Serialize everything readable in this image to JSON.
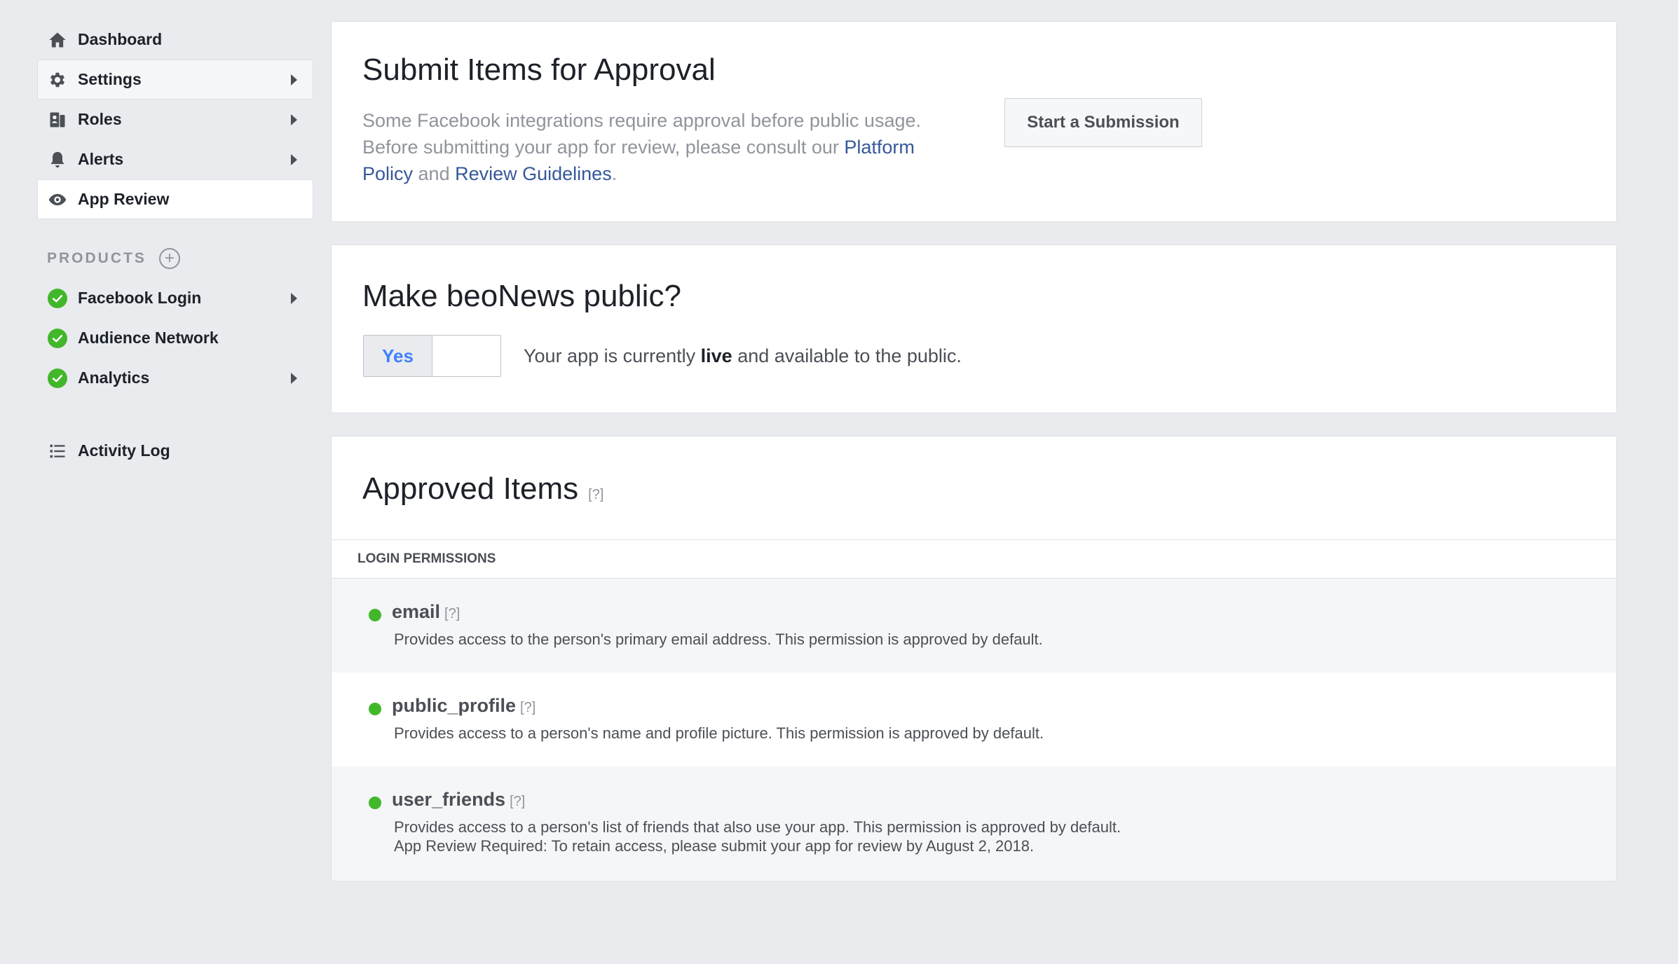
{
  "sidebar": {
    "items": [
      {
        "label": "Dashboard",
        "icon": "house-icon"
      },
      {
        "label": "Settings",
        "icon": "gear-icon"
      },
      {
        "label": "Roles",
        "icon": "roles-icon"
      },
      {
        "label": "Alerts",
        "icon": "bell-icon"
      },
      {
        "label": "App Review",
        "icon": "eye-icon"
      }
    ],
    "products_label": "PRODUCTS",
    "products_add_symbol": "+",
    "products": [
      {
        "label": "Facebook Login",
        "icon": "check-circle-icon"
      },
      {
        "label": "Audience Network",
        "icon": "check-circle-icon"
      },
      {
        "label": "Analytics",
        "icon": "check-circle-icon"
      }
    ],
    "activity_log": {
      "label": "Activity Log",
      "icon": "list-icon"
    }
  },
  "submit": {
    "title": "Submit Items for Approval",
    "desc_part1": "Some Facebook integrations require approval before public usage. Before submitting your app for review, please consult our ",
    "link_platform_policy": "Platform Policy",
    "desc_and": " and ",
    "link_review_guidelines": "Review Guidelines",
    "desc_end": ".",
    "button_label": "Start a Submission"
  },
  "public": {
    "title": "Make beoNews public?",
    "toggle_yes": "Yes",
    "status_prefix": "Your app is currently ",
    "status_bold": "live",
    "status_suffix": " and available to the public."
  },
  "approved": {
    "title": "Approved Items",
    "help": "[?]",
    "section_label": "LOGIN PERMISSIONS",
    "permissions": [
      {
        "name": "email",
        "help": "[?]",
        "desc": "Provides access to the person's primary email address. This permission is approved by default.",
        "desc2": ""
      },
      {
        "name": "public_profile",
        "help": "[?]",
        "desc": "Provides access to a person's name and profile picture. This permission is approved by default.",
        "desc2": ""
      },
      {
        "name": "user_friends",
        "help": "[?]",
        "desc": "Provides access to a person's list of friends that also use your app. This permission is approved by default.",
        "desc2": "App Review Required: To retain access, please submit your app for review by August 2, 2018."
      }
    ]
  },
  "colors": {
    "background": "#e9ebee",
    "link": "#365899",
    "approved_green": "#42b72a",
    "toggle_blue": "#4080ff"
  }
}
